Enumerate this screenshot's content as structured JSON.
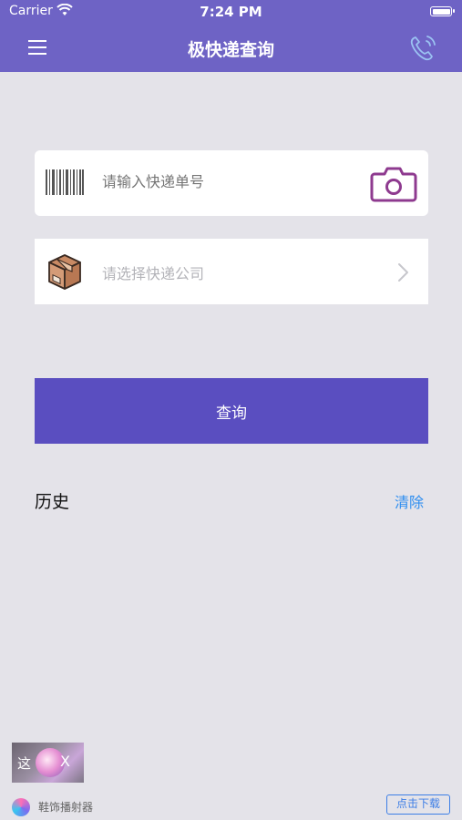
{
  "status_bar": {
    "carrier": "Carrier",
    "time": "7:24 PM"
  },
  "header": {
    "title": "极快递查询"
  },
  "form": {
    "tracking_placeholder": "请输入快递单号",
    "company_placeholder": "请选择快递公司",
    "submit_label": "查询"
  },
  "history": {
    "title": "历史",
    "clear_label": "清除"
  },
  "ad": {
    "thumb_text": "这",
    "close_label": "X",
    "app_name": "鞋饰播射器",
    "download_label": "点击下载"
  },
  "colors": {
    "header": "#6e63c5",
    "button": "#5a4ec0",
    "link": "#2e8ef0",
    "camera": "#8e3a8f",
    "background": "#e4e3e9"
  },
  "icons": [
    "menu-icon",
    "phone-icon",
    "barcode-icon",
    "camera-icon",
    "package-box-icon",
    "chevron-right-icon"
  ]
}
